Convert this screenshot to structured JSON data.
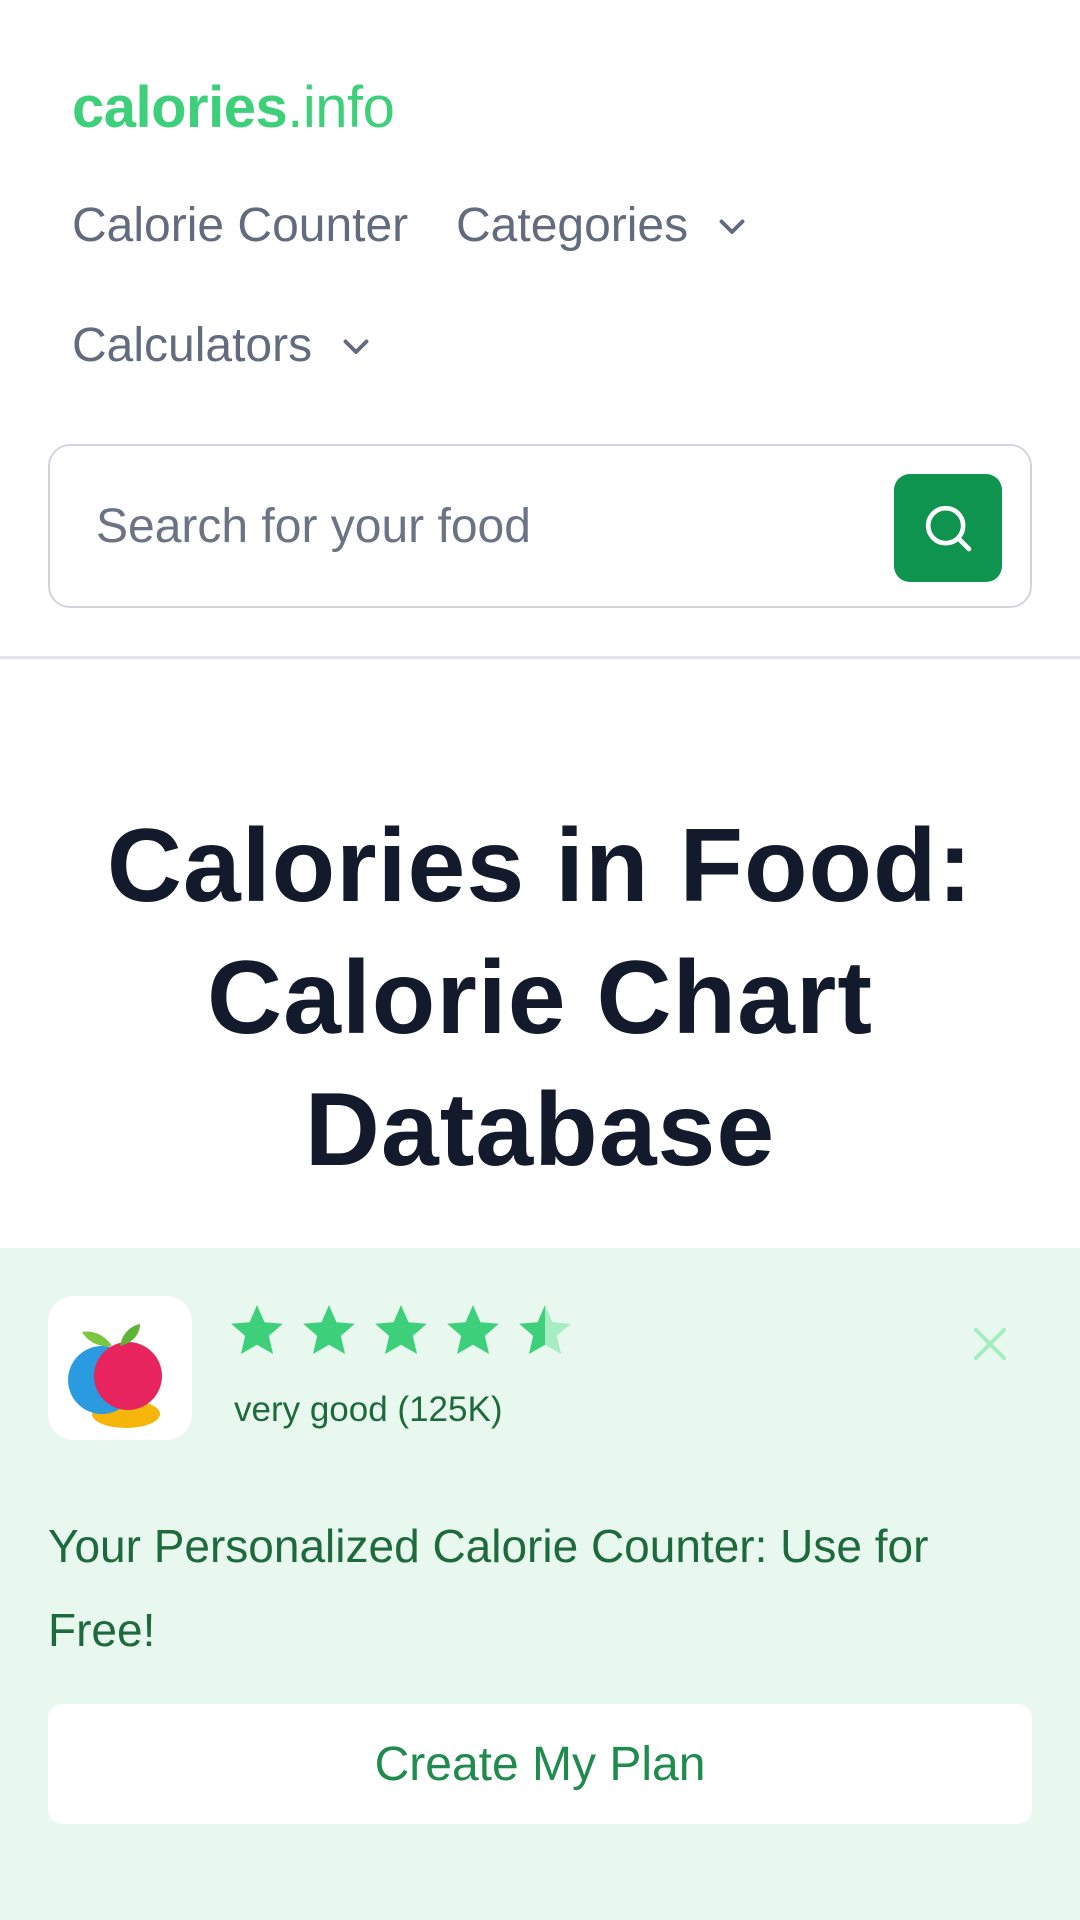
{
  "logo": {
    "bold": "calories",
    "light": ".info"
  },
  "nav": {
    "calorie_counter": "Calorie Counter",
    "categories": "Categories",
    "calculators": "Calculators"
  },
  "search": {
    "placeholder": "Search for your food",
    "value": ""
  },
  "page": {
    "title": "Calories in Food: Calorie Chart Database"
  },
  "promo": {
    "rating_stars": 4.5,
    "rating_text": "very good (125K)",
    "headline": "Your Personalized Calorie Counter: Use for Free!",
    "cta_label": "Create My Plan"
  },
  "colors": {
    "brand_green": "#3ecf7a",
    "button_green": "#0f9450",
    "promo_bg": "#e9f8ef",
    "promo_text": "#1d6a3c",
    "title_text": "#131a2b",
    "nav_text": "#636b7e"
  },
  "icons": {
    "search": "search-icon",
    "chevron": "chevron-down-icon",
    "close": "close-icon",
    "star": "star-icon",
    "app": "apple-app-icon"
  }
}
